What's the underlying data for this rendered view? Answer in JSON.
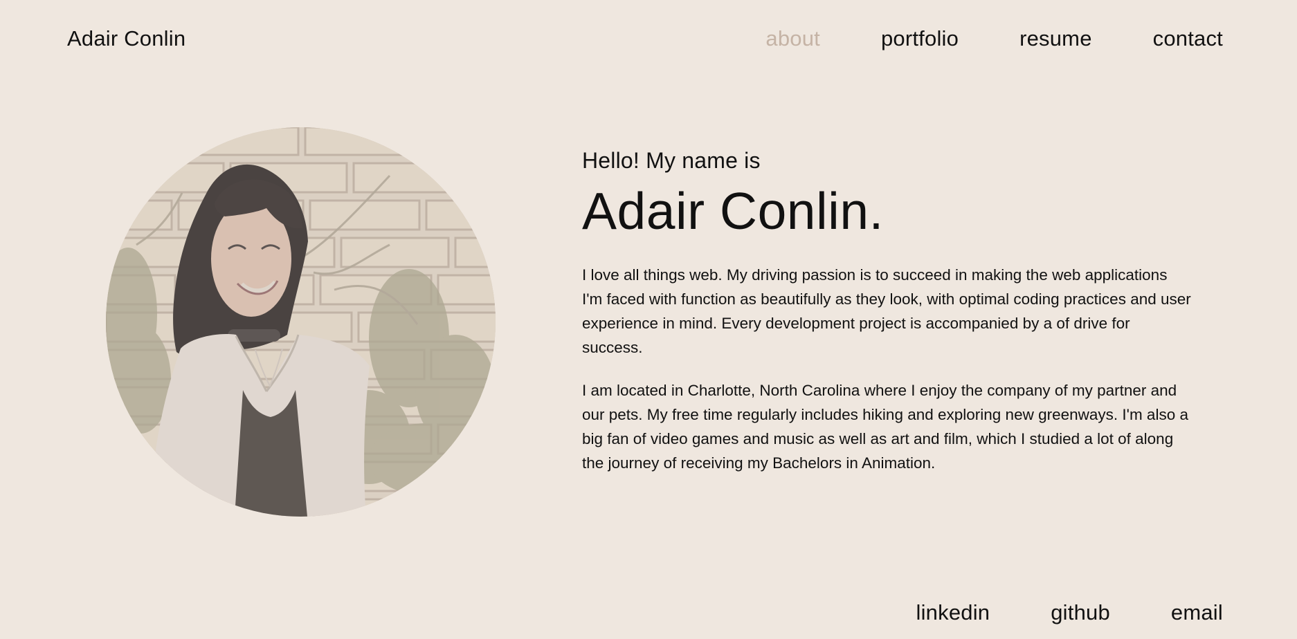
{
  "header": {
    "logo": "Adair Conlin",
    "nav": [
      {
        "label": "about",
        "active": true
      },
      {
        "label": "portfolio",
        "active": false
      },
      {
        "label": "resume",
        "active": false
      },
      {
        "label": "contact",
        "active": false
      }
    ]
  },
  "hero": {
    "greeting": "Hello! My name is",
    "name": "Adair Conlin.",
    "bio": [
      "I love all things web. My driving passion is to succeed in making the web applications I'm faced with function as beautifully as they look, with optimal coding practices and user experience in mind. Every development project is accompanied by a of drive for success.",
      "I am located in Charlotte, North Carolina where I enjoy the company of my partner and our pets. My free time regularly includes hiking and exploring new greenways. I'm also a big fan of video games and music as well as art and film, which I studied a lot of along the journey of receiving my Bachelors in Animation."
    ]
  },
  "footer": {
    "links": [
      {
        "label": "linkedin"
      },
      {
        "label": "github"
      },
      {
        "label": "email"
      }
    ]
  },
  "colors": {
    "background": "#efe7df",
    "text": "#111111",
    "active_nav": "#c5b3a5"
  }
}
